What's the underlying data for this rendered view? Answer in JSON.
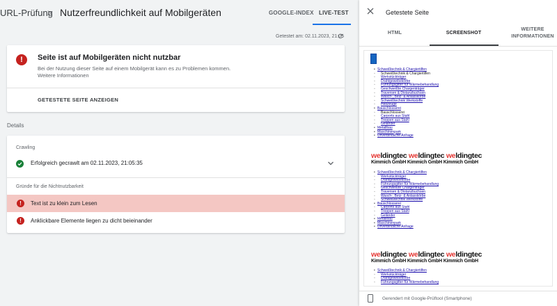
{
  "header": {
    "breadcrumb_root": "URL-Prüfung",
    "breadcrumb_sep": ">",
    "title": "Nutzerfreundlichkeit auf Mobilgeräten",
    "tabs": [
      "GOOGLE-INDEX",
      "LIVE-TEST"
    ],
    "active_tab": "LIVE-TEST"
  },
  "tested": "Getestet am: 02.11.2023, 21:05",
  "status_card": {
    "title": "Seite ist auf Mobilgeräten nicht nutzbar",
    "description": "Bei der Nutzung dieser Seite auf einem Mobilgerät kann es zu Problemen kommen.",
    "link": "Weitere Informationen",
    "button": "GETESTETE SEITE ANZEIGEN"
  },
  "details": {
    "label": "Details",
    "crawling_label": "Crawling",
    "crawling_status": "Erfolgreich gecrawlt am 02.11.2023, 21:05:35",
    "reasons_label": "Gründe für die Nichtnutzbarkeit",
    "reasons": [
      "Text ist zu klein zum Lesen",
      "Anklickbare Elemente liegen zu dicht beieinander"
    ]
  },
  "panel": {
    "title": "Getestete Seite",
    "tabs": [
      "HTML",
      "SCREENSHOT",
      "WEITERE INFORMATIONEN"
    ],
    "active_tab": "SCREENSHOT",
    "footer": "Gerendert mit Google-Prüftool (Smartphone)"
  },
  "preview": {
    "menu1": {
      "schweiss": "Schweißtechnik & Chargiertilfen",
      "sub_black": "Schweißtechnik & Chargiertilfen",
      "items": [
        "Werkstückträger",
        "Drahtgewebekörbe",
        "Führungsgitter für Wärmebehandlung",
        "Geschweißte Chargenträger",
        "Traversen & Distanzbuchsen",
        "Wasch-, Beiz- & Anlasskörbe",
        "Schweißtechnik Werkstoffe",
        "Hebzeuge"
      ],
      "bau": "Bauschlosserei",
      "bau_black": "Bauschlosserei",
      "bau_items": [
        "Carports aus Stahl",
        "Treppen aus Stahl",
        "Geländer"
      ],
      "tail": [
        "Metallbau",
        "Maschinenpark",
        "Unverbindliche Anfrage"
      ]
    },
    "logo": {
      "line1_parts": [
        "we",
        "ldingtec ",
        "we",
        "ldingtec ",
        "we",
        "ldingtec"
      ],
      "line2": "Kimmich GmbH Kimmich GmbH Kimmich GmbH"
    },
    "menu2": {
      "schweiss": "Schweißtechnik & Chargiertilfen",
      "items": [
        "Werkstückträger",
        "Drahtgewebekörbe",
        "Führungsgitter für Wärmebehandlung",
        "Geschweißte Chargenträger",
        "Traversen & Distanzbuchsen",
        "Wasch-, Beiz- & Anlasskörbe",
        "Schweißtechnik Werkstoffe"
      ],
      "bau": "Bauschlosserei",
      "bau_items": [
        "Carports aus Stahl",
        "Treppen aus Stahl",
        "Geländer"
      ],
      "tail": [
        "Metallbau",
        "Maschinenpark",
        "Unverbindliche Anfrage"
      ]
    },
    "menu3": {
      "schweiss": "Schweißtechnik & Chargiertilfen",
      "items": [
        "Werkstückträger",
        "Drahtgewebekörbe",
        "Führungsgitter für Wärmebehandlung"
      ]
    }
  }
}
